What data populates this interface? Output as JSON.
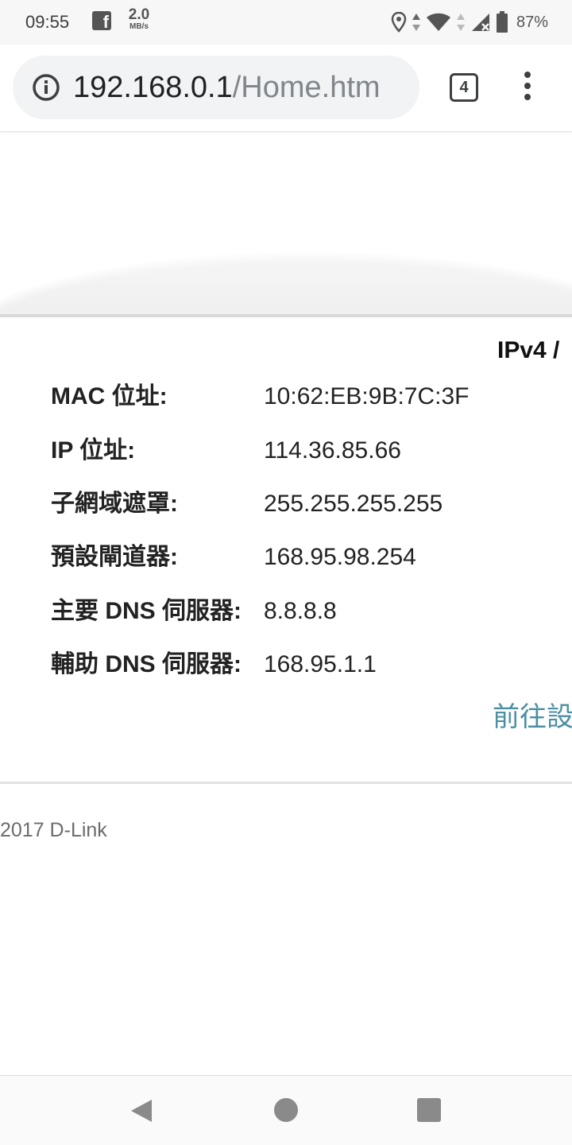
{
  "status_bar": {
    "time": "09:55",
    "notification_icon": "facebook-icon",
    "speed_value": "2.0",
    "speed_unit": "MB/s",
    "battery_percent": "87%",
    "icons": [
      "location-icon",
      "data-arrows-icon",
      "wifi-icon",
      "cellular-no-signal-icon",
      "battery-icon"
    ]
  },
  "browser": {
    "url_host": "192.168.0.1",
    "url_path": "/Home.htm",
    "tab_count": "4",
    "info_icon": "info-icon",
    "menu_icon": "more-vert-icon"
  },
  "main": {
    "tab_label": "IPv4 /",
    "rows": [
      {
        "label": "MAC 位址:",
        "value": "10:62:EB:9B:7C:3F"
      },
      {
        "label": "IP 位址:",
        "value": "114.36.85.66"
      },
      {
        "label": "子網域遮罩:",
        "value": "255.255.255.255"
      },
      {
        "label": "預設閘道器:",
        "value": "168.95.98.254"
      },
      {
        "label": "主要 DNS 伺服器:",
        "value": "8.8.8.8"
      },
      {
        "label": "輔助 DNS 伺服器:",
        "value": "168.95.1.1"
      }
    ],
    "settings_link": "前往設"
  },
  "footer": {
    "copyright": "2017 D-Link"
  },
  "nav_bar": {
    "back_icon": "back-triangle-icon",
    "home_icon": "home-circle-icon",
    "recents_icon": "recents-square-icon"
  },
  "colors": {
    "link": "#4b8fa3",
    "url_bar_bg": "#f1f3f4",
    "status_bar_bg": "#f7f7f7"
  }
}
